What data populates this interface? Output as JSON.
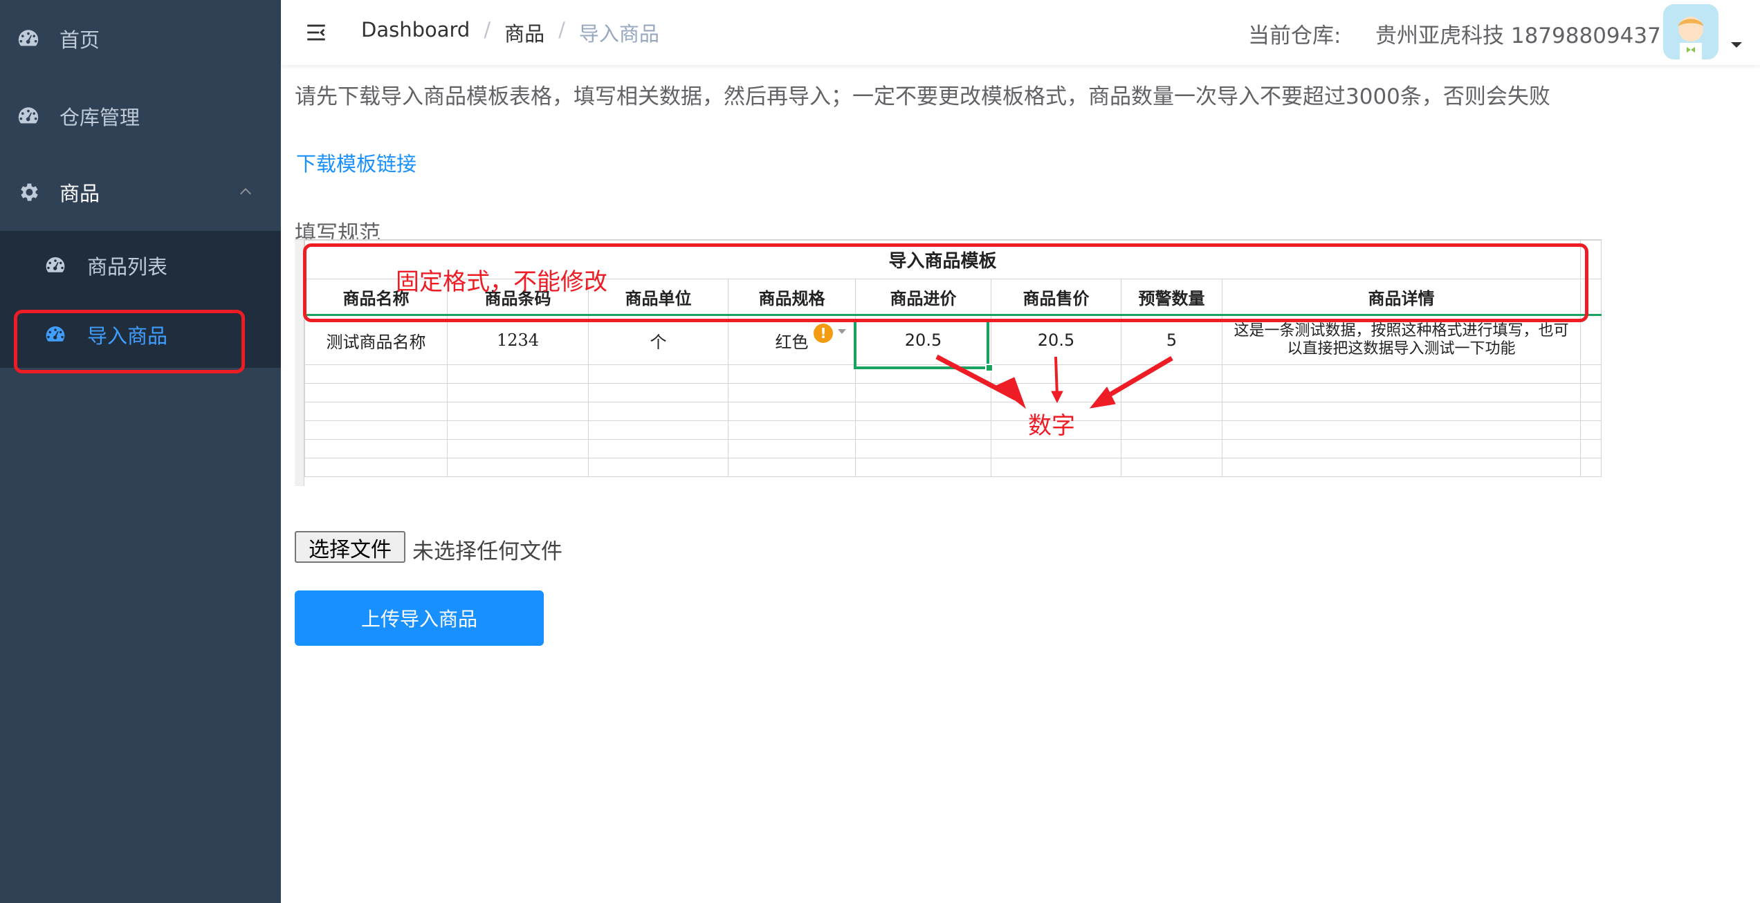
{
  "sidebar": {
    "items": [
      {
        "label": "首页",
        "icon": "dashboard-icon"
      },
      {
        "label": "仓库管理",
        "icon": "dashboard-icon"
      },
      {
        "label": "商品",
        "icon": "gear-icon"
      }
    ],
    "sub_items": [
      {
        "label": "商品列表",
        "icon": "dashboard-icon",
        "active": false
      },
      {
        "label": "导入商品",
        "icon": "dashboard-icon",
        "active": true
      }
    ],
    "colors": {
      "bg": "#304156",
      "sub_bg": "#1f2d3d",
      "text": "#bfcbd9",
      "active": "#409eff"
    }
  },
  "header": {
    "breadcrumb": [
      "Dashboard",
      "商品",
      "导入商品"
    ],
    "warehouse_label": "当前仓库:",
    "warehouse_value": "贵州亚虎科技 18798809437"
  },
  "main": {
    "tip": "请先下载导入商品模板表格，填写相关数据，然后再导入；一定不要更改模板格式，商品数量一次导入不要超过3000条，否则会失败",
    "download_link": "下载模板链接",
    "spec_title": "填写规范",
    "sheet": {
      "title": "导入商品模板",
      "headers": [
        "商品名称",
        "商品条码",
        "商品单位",
        "商品规格",
        "商品进价",
        "商品售价",
        "预警数量",
        "商品详情"
      ],
      "row": [
        "测试商品名称",
        "1234",
        "个",
        "红色",
        "20.5",
        "20.5",
        "5",
        "这是一条测试数据，按照这种格式进行填写，也可以直接把这数据导入测试一下功能"
      ]
    },
    "annotations": {
      "fixed_format": "固定格式，不能修改",
      "number": "数字",
      "color": "#ee1c25"
    },
    "file_button": "选择文件",
    "file_status": "未选择任何文件",
    "upload_button": "上传导入商品",
    "accent": "#1890ff"
  }
}
